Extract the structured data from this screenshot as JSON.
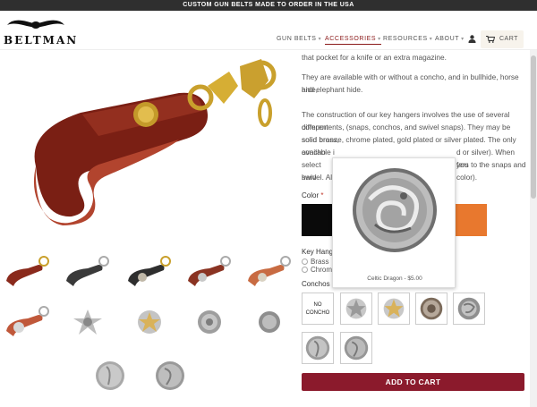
{
  "topbar": {
    "text": "CUSTOM GUN BELTS MADE TO ORDER IN THE USA"
  },
  "brand": {
    "name": "BELTMAN"
  },
  "nav": {
    "items": [
      {
        "label": "GUN BELTS"
      },
      {
        "label": "ACCESSORIES"
      },
      {
        "label": "RESOURCES"
      },
      {
        "label": "ABOUT"
      }
    ],
    "cart_label": "CART"
  },
  "product": {
    "desc_1": "that pocket for a knife or an extra magazine.",
    "desc_2a": "They are available with or without a concho, and in bullhide, horse hide,",
    "desc_2b": "and elephant hide.",
    "desc_3a": "The construction of our key hangers involves the use of several different",
    "desc_3b": "components, (snaps, conchos, and swivel snaps). They may be solid brass,",
    "desc_3c": "solid bronze, chrome plated, gold plated or silver plated. The only concho",
    "desc_3d": "available i",
    "desc_3d_end": "d or silver). When you",
    "desc_3e": "select hard",
    "desc_3e_end": "fers to the snaps and",
    "desc_3f": "swivel. All",
    "desc_3f_end": "color)."
  },
  "options": {
    "color_label": "Color",
    "hang_label": "Key Hang",
    "hang_brass": "Brass",
    "hang_chrome": "Chrome",
    "conchos_label": "Conchos",
    "no_concho_line1": "NO",
    "no_concho_line2": "CONCHO",
    "required_mark": "*"
  },
  "popup": {
    "caption": "Celtic Dragon - $5.00"
  },
  "add_to_cart": "ADD TO CART",
  "colors": {
    "accent": "#8b1a2c",
    "swatch_black": "#0a0a0a",
    "swatch_orange": "#e8782e",
    "leather": "#8a2a1c"
  }
}
